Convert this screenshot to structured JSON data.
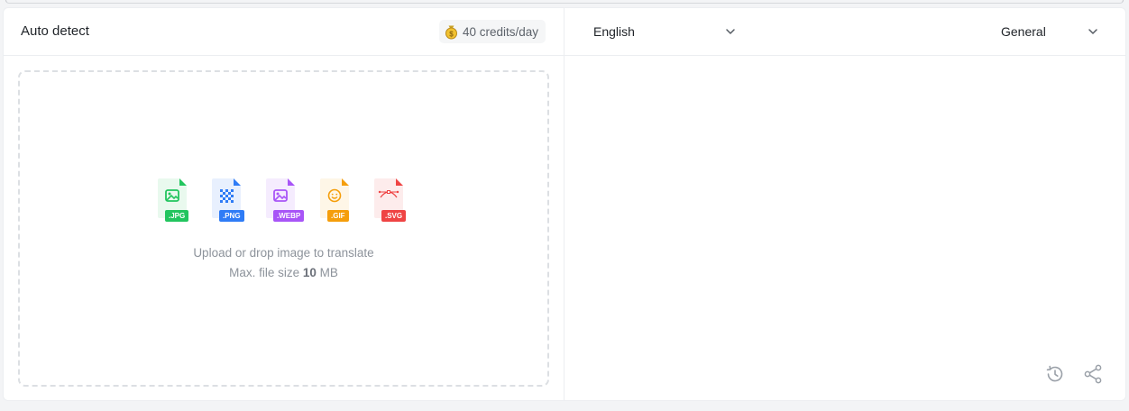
{
  "source": {
    "language": "Auto detect",
    "credits": "40 credits/day"
  },
  "target": {
    "language": "English",
    "domain": "General"
  },
  "upload": {
    "prompt": "Upload or drop image to translate",
    "max_size_prefix": "Max. file size",
    "max_size_value": "10",
    "max_size_unit": "MB",
    "formats": [
      {
        "label": ".JPG",
        "color": "#22c55e",
        "bg": "#e9f9ee",
        "icon": "image-icon"
      },
      {
        "label": ".PNG",
        "color": "#2f7cf6",
        "bg": "#e8f0fe",
        "icon": "checker-icon"
      },
      {
        "label": ".WEBP",
        "color": "#a855f7",
        "bg": "#f5ecfe",
        "icon": "image-icon"
      },
      {
        "label": ".GIF",
        "color": "#f59e0b",
        "bg": "#fef6e7",
        "icon": "smiley-icon"
      },
      {
        "label": ".SVG",
        "color": "#ef4444",
        "bg": "#fdecec",
        "icon": "bezier-icon"
      }
    ]
  },
  "icons": {
    "credits": "coin-icon",
    "dropdown": "chevron-down-icon",
    "history": "history-icon",
    "share": "share-icon"
  }
}
